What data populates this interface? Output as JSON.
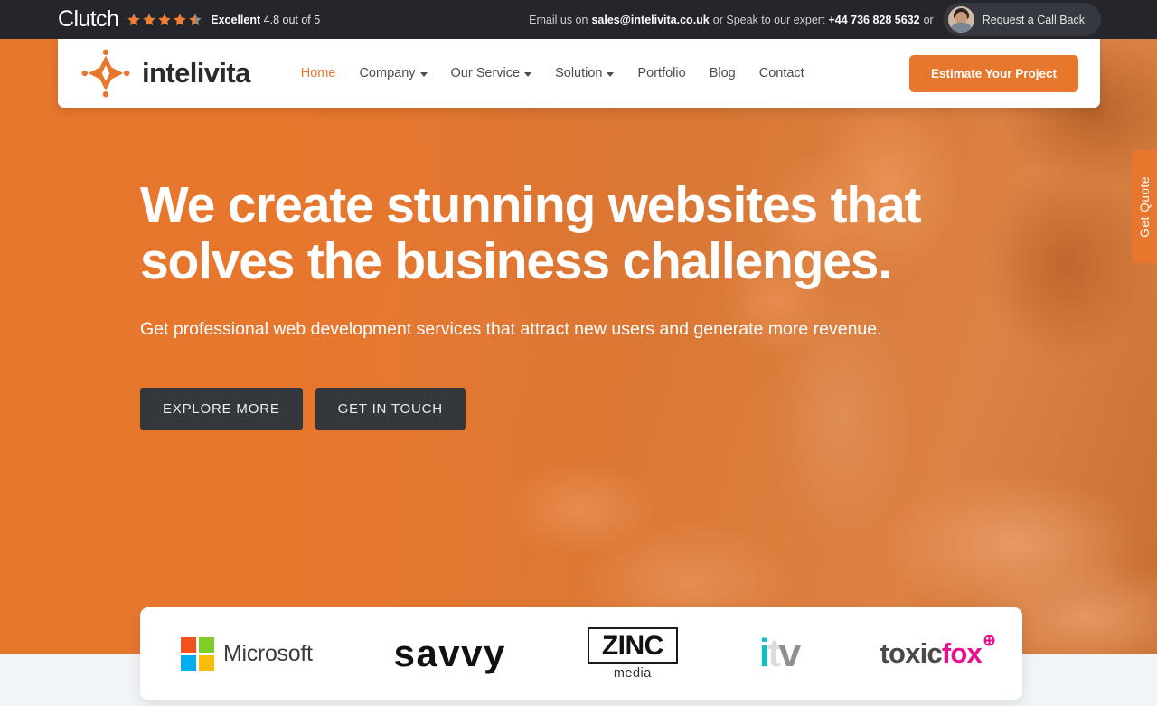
{
  "topbar": {
    "clutch_brand": "Clutch",
    "rating_label": "Excellent",
    "rating_value": "4.8 out of 5",
    "stars_total": 5,
    "stars_filled": 4.5,
    "email_prefix": "Email us on",
    "email": "sales@intelivita.co.uk",
    "expert_prefix": "or Speak to our expert",
    "phone": "+44 736 828 5632",
    "or_label": "or",
    "callback_label": "Request a Call Back",
    "avatar_icon": "user-avatar-photo",
    "background_color": "#24262b"
  },
  "nav": {
    "logo_icon": "intelivita-star-logo",
    "logo_text": "intelivita",
    "items": [
      {
        "label": "Home",
        "has_dropdown": false,
        "active": true
      },
      {
        "label": "Company",
        "has_dropdown": true,
        "active": false
      },
      {
        "label": "Our Service",
        "has_dropdown": true,
        "active": false
      },
      {
        "label": "Solution",
        "has_dropdown": true,
        "active": false
      },
      {
        "label": "Portfolio",
        "has_dropdown": false,
        "active": false
      },
      {
        "label": "Blog",
        "has_dropdown": false,
        "active": false
      },
      {
        "label": "Contact",
        "has_dropdown": false,
        "active": false
      }
    ],
    "cta_label": "Estimate Your Project",
    "accent_color": "#e8772e"
  },
  "hero": {
    "title_line1": "We create stunning websites that",
    "title_line2": "solves the business challenges.",
    "subtitle": "Get professional web development services that attract new users and generate more revenue.",
    "primary_button": "EXPLORE MORE",
    "secondary_button": "GET IN TOUCH",
    "overlay_color": "#e8772e",
    "button_color": "#34373c"
  },
  "side_tab": {
    "label": "Get Quote",
    "color": "#e8772e"
  },
  "clients": {
    "items": [
      {
        "name": "Microsoft",
        "icon": "microsoft-logo",
        "word": "Microsoft"
      },
      {
        "name": "Savvy",
        "icon": "savvy-logo",
        "word": "savvy"
      },
      {
        "name": "Zinc Media",
        "icon": "zinc-media-logo",
        "word": "ZINC",
        "sub": "media"
      },
      {
        "name": "ITV",
        "icon": "itv-logo",
        "part1": "i",
        "part2": "t",
        "part3": "v"
      },
      {
        "name": "ToxicFox",
        "icon": "toxicfox-logo",
        "part1": "toxic",
        "part2": "fox"
      }
    ]
  }
}
